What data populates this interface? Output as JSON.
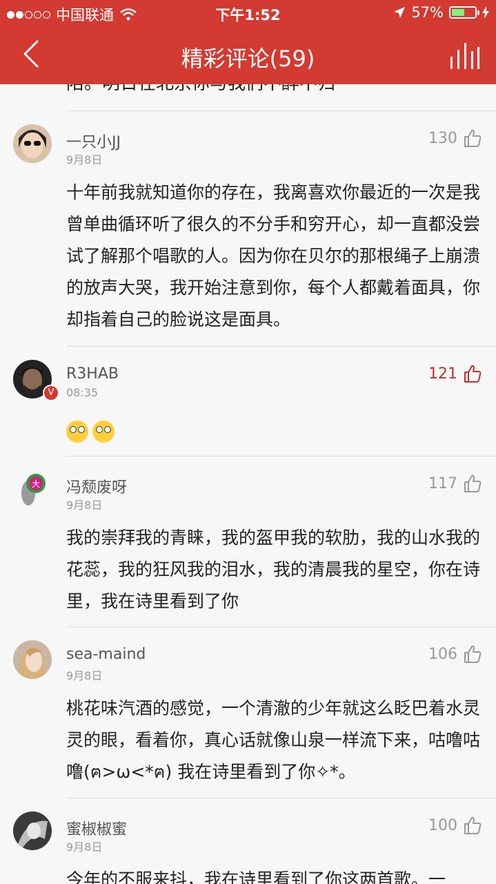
{
  "status": {
    "carrier": "中国联通",
    "time": "下午1:52",
    "battery": "57%",
    "battery_level": 0.57
  },
  "nav": {
    "title": "精彩评论(59)"
  },
  "prev_tail": "陪。明日在北京你与我们不醉不归",
  "comments": [
    {
      "user": "一只小JJ",
      "date": "9月8日",
      "likes": "130",
      "text": "十年前我就知道你的存在，我离喜欢你最近的一次是我曾单曲循环听了很久的不分手和穷开心，却一直都没尝试了解那个唱歌的人。因为你在贝尔的那根绳子上崩溃的放声大哭，我开始注意到你，每个人都戴着面具，你却指着自己的脸说这是面具。"
    },
    {
      "user": "R3HAB",
      "date": "08:35",
      "likes": "121",
      "verified": "V",
      "liked": true
    },
    {
      "user": "冯颓废呀",
      "date": "9月8日",
      "likes": "117",
      "text": "我的崇拜我的青睐，我的盔甲我的软肋，我的山水我的花蕊，我的狂风我的泪水，我的清晨我的星空，你在诗里，我在诗里看到了你"
    },
    {
      "user": "sea-maind",
      "date": "9月8日",
      "likes": "106",
      "text": "桃花味汽酒的感觉，一个清澈的少年就这么眨巴着水灵灵的眼，看着你，真心话就像山泉一样流下来，咕噜咕噜(ฅ>ω<*ฅ) 我在诗里看到了你✧*。"
    },
    {
      "user": "蜜椒椒蜜",
      "date": "9月8日",
      "likes": "100",
      "text": "今年的不服来抖，我在诗里看到了你这两首歌。一"
    }
  ]
}
